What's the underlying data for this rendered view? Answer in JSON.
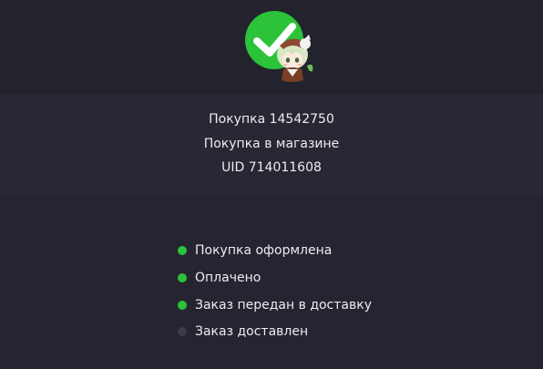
{
  "header": {
    "status_icon": "check-circle-icon",
    "mascot_icon": "chibi-character-sticker",
    "accent_color": "#2cc23a"
  },
  "order": {
    "purchase_line": "Покупка 14542750",
    "source_line": "Покупка в магазине",
    "uid_line": "UID 714011608"
  },
  "statuses": [
    {
      "label": "Покупка оформлена",
      "done": true
    },
    {
      "label": "Оплачено",
      "done": true
    },
    {
      "label": "Заказ передан в доставку",
      "done": true
    },
    {
      "label": "Заказ доставлен",
      "done": false
    }
  ],
  "colors": {
    "done": "#2cc23a",
    "pending": "#3a3b47"
  }
}
